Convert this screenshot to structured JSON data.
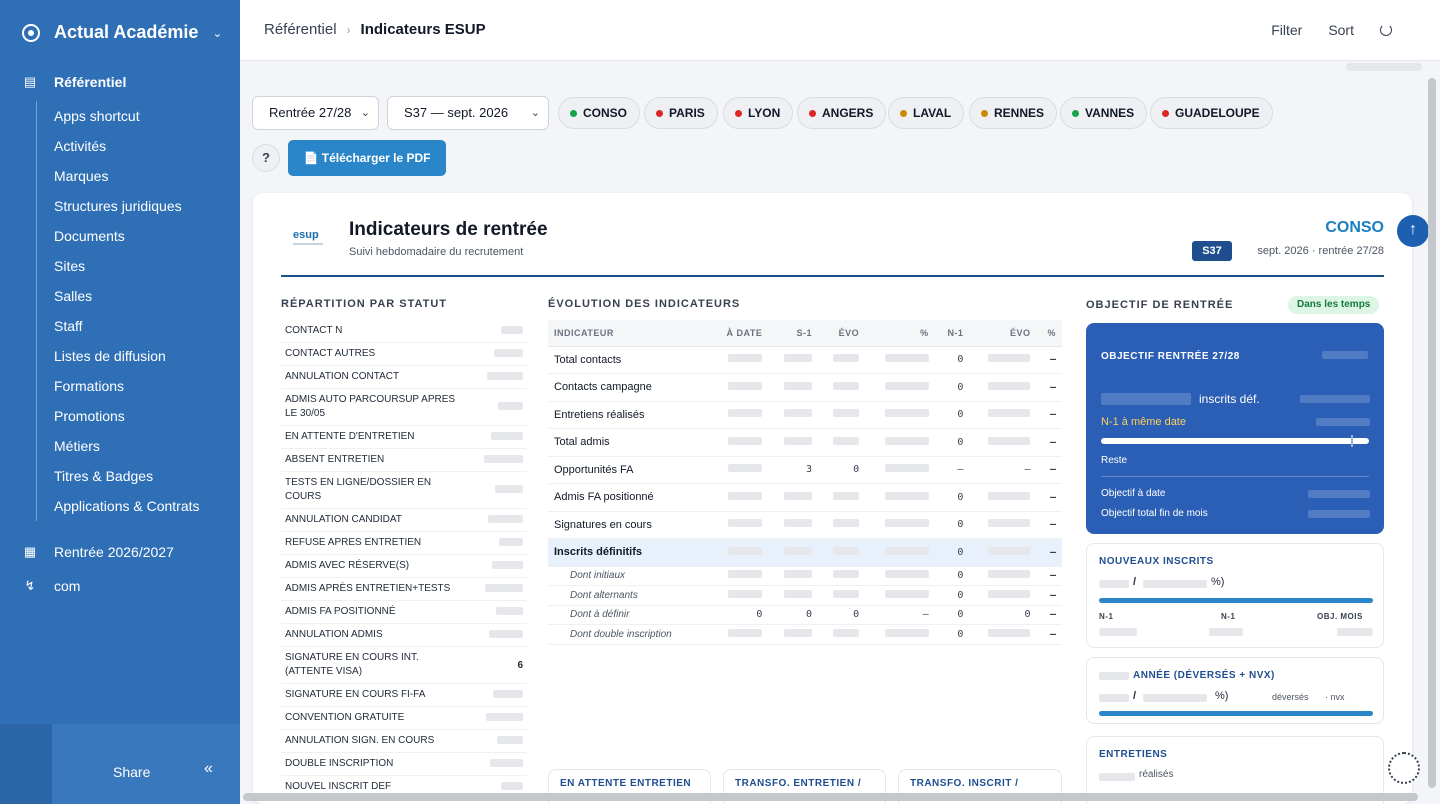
{
  "sidebar": {
    "brand": "Actual Académie",
    "sections": {
      "referentiel": "Référentiel",
      "rentree": "Rentrée 2026/2027",
      "com": "com"
    },
    "items": [
      {
        "label": "Apps shortcut"
      },
      {
        "label": "Activités"
      },
      {
        "label": "Marques"
      },
      {
        "label": "Structures juridiques"
      },
      {
        "label": "Documents"
      },
      {
        "label": "Sites"
      },
      {
        "label": "Salles"
      },
      {
        "label": "Staff"
      },
      {
        "label": "Listes de diffusion"
      },
      {
        "label": "Formations"
      },
      {
        "label": "Promotions"
      },
      {
        "label": "Métiers"
      },
      {
        "label": "Titres & Badges"
      },
      {
        "label": "Applications & Contrats"
      }
    ],
    "share": "Share"
  },
  "header": {
    "breadcrumb_root": "Référentiel",
    "breadcrumb_current": "Indicateurs ESUP",
    "filter": "Filter",
    "sort": "Sort"
  },
  "filters": {
    "rentree": "Rentrée 27/28",
    "week": "S37 —      sept. 2026",
    "sites": [
      {
        "label": "CONSO",
        "color": "#16a34a"
      },
      {
        "label": "PARIS",
        "color": "#dc2626"
      },
      {
        "label": "LYON",
        "color": "#dc2626"
      },
      {
        "label": "ANGERS",
        "color": "#dc2626"
      },
      {
        "label": "LAVAL",
        "color": "#ca8a04"
      },
      {
        "label": "RENNES",
        "color": "#ca8a04"
      },
      {
        "label": "VANNES",
        "color": "#16a34a"
      },
      {
        "label": "GUADELOUPE",
        "color": "#dc2626"
      }
    ],
    "help": "?",
    "pdf": "Télécharger le PDF"
  },
  "report": {
    "logo": "esup",
    "title": "Indicateurs de rentrée",
    "subtitle": "Suivi hebdomadaire du recrutement",
    "scope": "CONSO",
    "week_badge": "S37",
    "week_date": "sept. 2026 · rentrée 27/28",
    "status_title": "RÉPARTITION PAR STATUT",
    "status_rows": [
      {
        "label": "CONTACT N",
        "value": ""
      },
      {
        "label": "CONTACT AUTRES",
        "value": ""
      },
      {
        "label": "ANNULATION CONTACT",
        "value": ""
      },
      {
        "label": "ADMIS AUTO PARCOURSUP APRES LE 30/05",
        "value": ""
      },
      {
        "label": "EN ATTENTE D'ENTRETIEN",
        "value": ""
      },
      {
        "label": "ABSENT ENTRETIEN",
        "value": ""
      },
      {
        "label": "TESTS EN LIGNE/DOSSIER EN COURS",
        "value": ""
      },
      {
        "label": "ANNULATION CANDIDAT",
        "value": ""
      },
      {
        "label": "REFUSE APRES ENTRETIEN",
        "value": ""
      },
      {
        "label": "ADMIS AVEC RÉSERVE(S)",
        "value": ""
      },
      {
        "label": "ADMIS APRÈS ENTRETIEN+TESTS",
        "value": ""
      },
      {
        "label": "ADMIS FA POSITIONNÉ",
        "value": ""
      },
      {
        "label": "ANNULATION ADMIS",
        "value": ""
      },
      {
        "label": "SIGNATURE EN COURS INT. (ATTENTE VISA)",
        "value": "6"
      },
      {
        "label": "SIGNATURE EN COURS FI-FA",
        "value": ""
      },
      {
        "label": "CONVENTION GRATUITE",
        "value": ""
      },
      {
        "label": "ANNULATION SIGN. EN COURS",
        "value": ""
      },
      {
        "label": "DOUBLE INSCRIPTION",
        "value": ""
      },
      {
        "label": "NOUVEL INSCRIT DEF",
        "value": ""
      }
    ],
    "evo_title": "ÉVOLUTION DES INDICATEURS",
    "evo_headers": [
      "INDICATEUR",
      "À DATE",
      "S-1",
      "ÉVO",
      "%",
      "N-1",
      "ÉVO",
      "%"
    ],
    "evo_rows": [
      {
        "label": "Total contacts",
        "cells": [
          "",
          "",
          "",
          "",
          "0",
          "",
          "—"
        ]
      },
      {
        "label": "Contacts campagne",
        "cells": [
          "",
          "",
          "",
          "",
          "0",
          "",
          "—"
        ]
      },
      {
        "label": "Entretiens réalisés",
        "cells": [
          "",
          "",
          "",
          "",
          "0",
          "",
          "—"
        ]
      },
      {
        "label": "Total admis",
        "cells": [
          "",
          "",
          "",
          "",
          "0",
          "",
          "—"
        ]
      },
      {
        "label": "Opportunités FA",
        "cells": [
          "",
          "3",
          "0",
          "",
          "—",
          "—",
          "—"
        ]
      },
      {
        "label": "Admis FA positionné",
        "cells": [
          "",
          "",
          "",
          "",
          "0",
          "",
          "—"
        ]
      },
      {
        "label": "Signatures en cours",
        "cells": [
          "",
          "",
          "",
          "",
          "0",
          "",
          "—"
        ]
      },
      {
        "label": "Inscrits définitifs",
        "cells": [
          "",
          "",
          "",
          "",
          "0",
          "",
          "—"
        ]
      }
    ],
    "evo_sub_rows": [
      {
        "label": "Dont initiaux",
        "cells": [
          "",
          "",
          "",
          "",
          "0",
          "",
          "—"
        ]
      },
      {
        "label": "Dont alternants",
        "cells": [
          "",
          "",
          "",
          "",
          "0",
          "",
          "—"
        ]
      },
      {
        "label": "Dont à définir",
        "cells": [
          "0",
          "0",
          "0",
          "—",
          "0",
          "0",
          "—"
        ]
      },
      {
        "label": "Dont double inscription",
        "cells": [
          "",
          "",
          "",
          "",
          "0",
          "",
          "—"
        ]
      }
    ],
    "objective_title": "OBJECTIF DE RENTRÉE",
    "on_time": "Dans les temps",
    "objective_card": {
      "title": "OBJECTIF RENTRÉE 27/28",
      "inscrits": "inscrits déf.",
      "n1": "N-1 à même date",
      "reste": "Reste",
      "obj_date": "Objectif à date",
      "obj_total": "Objectif total fin de mois"
    },
    "new_enrolled": {
      "title": "NOUVEAUX INSCRITS",
      "slash": "/",
      "pct_close": "%)",
      "n1": "N-1",
      "n1b": "N-1",
      "obj": "OBJ. MOIS"
    },
    "year": {
      "title": "ANNÉE (DÉVERSÉS + NVX)",
      "slash": "/",
      "pct_close": "%)",
      "deverses": "déversés",
      "nvx": "· nvx"
    },
    "interviews": {
      "title": "ENTRETIENS",
      "realises": "réalisés"
    },
    "bottom_tabs": [
      "EN ATTENTE ENTRETIEN",
      "TRANSFO. ENTRETIEN /",
      "TRANSFO. INSCRIT /"
    ]
  }
}
